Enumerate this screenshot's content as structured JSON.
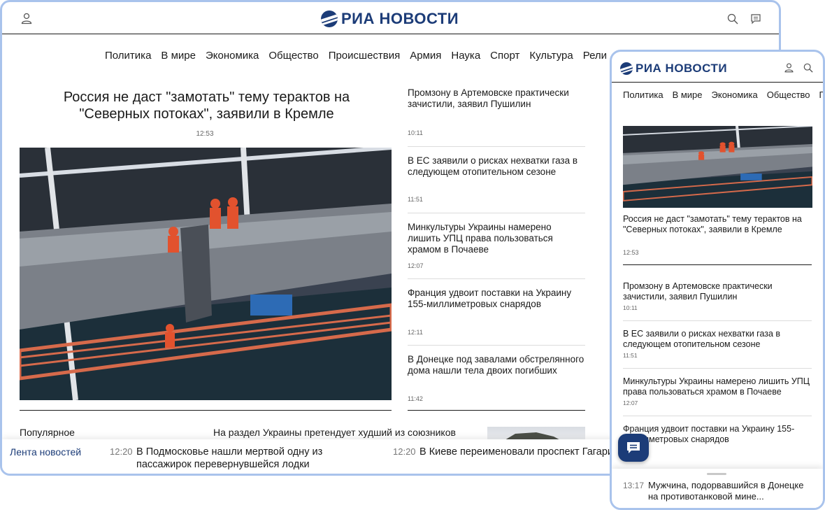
{
  "desktop": {
    "logo_text": "РИА НОВОСТИ",
    "nav": [
      "Политика",
      "В мире",
      "Экономика",
      "Общество",
      "Происшествия",
      "Армия",
      "Наука",
      "Спорт",
      "Культура",
      "Рели"
    ],
    "main": {
      "title": "Россия не даст \"замотать\" тему терактов на \"Северных потоках\", заявили в Кремле",
      "time": "12:53"
    },
    "news": [
      {
        "title": "Промзону в Артемовске практически зачистили, заявил Пушилин",
        "time": "10:11"
      },
      {
        "title": "В ЕС заявили о рисках нехватки газа в следующем отопительном сезоне",
        "time": "11:51"
      },
      {
        "title": "Минкультуры Украины намерено лишить УПЦ права пользоваться храмом в Почаеве",
        "time": "12:07"
      },
      {
        "title": "Франция удвоит поставки на Украину 155-миллиметровых снарядов",
        "time": "12:11"
      },
      {
        "title": "В Донецке под завалами обстрелянного дома нашли тела двоих погибших",
        "time": "11:42"
      }
    ],
    "popular_label": "Популярное",
    "popular_headline": "На раздел Украины претендует худший из союзников",
    "ticker": {
      "label": "Лента новостей",
      "items": [
        {
          "time": "12:20",
          "text": "В Подмосковье нашли мертвой одну из пассажирок перевернувшейся лодки"
        },
        {
          "time": "12:20",
          "text": "В Киеве переименовали проспект Гагари"
        }
      ]
    }
  },
  "mobile": {
    "logo_text": "РИА НОВОСТИ",
    "nav": [
      "Политика",
      "В мире",
      "Экономика",
      "Общество",
      "П"
    ],
    "main": {
      "title": "Россия не даст \"замотать\" тему терактов на \"Северных потоках\", заявили в Кремле",
      "time": "12:53"
    },
    "news": [
      {
        "title": "Промзону в Артемовске практически зачистили, заявил Пушилин",
        "time": "10:11"
      },
      {
        "title": "В ЕС заявили о рисках нехватки газа в следующем отопительном сезоне",
        "time": "11:51"
      },
      {
        "title": "Минкультуры Украины намерено лишить УПЦ права пользоваться храмом в Почаеве",
        "time": "12:07"
      },
      {
        "title": "Франция удвоит поставки на Украину 155-миллиметровых снарядов",
        "time": ""
      }
    ],
    "ticker": {
      "time": "13:17",
      "text": "Мужчина, подорвавшийся в Донецке на противотанковой мине..."
    }
  },
  "colors": {
    "brand": "#1c3c78",
    "frame": "#a9c3ec"
  }
}
